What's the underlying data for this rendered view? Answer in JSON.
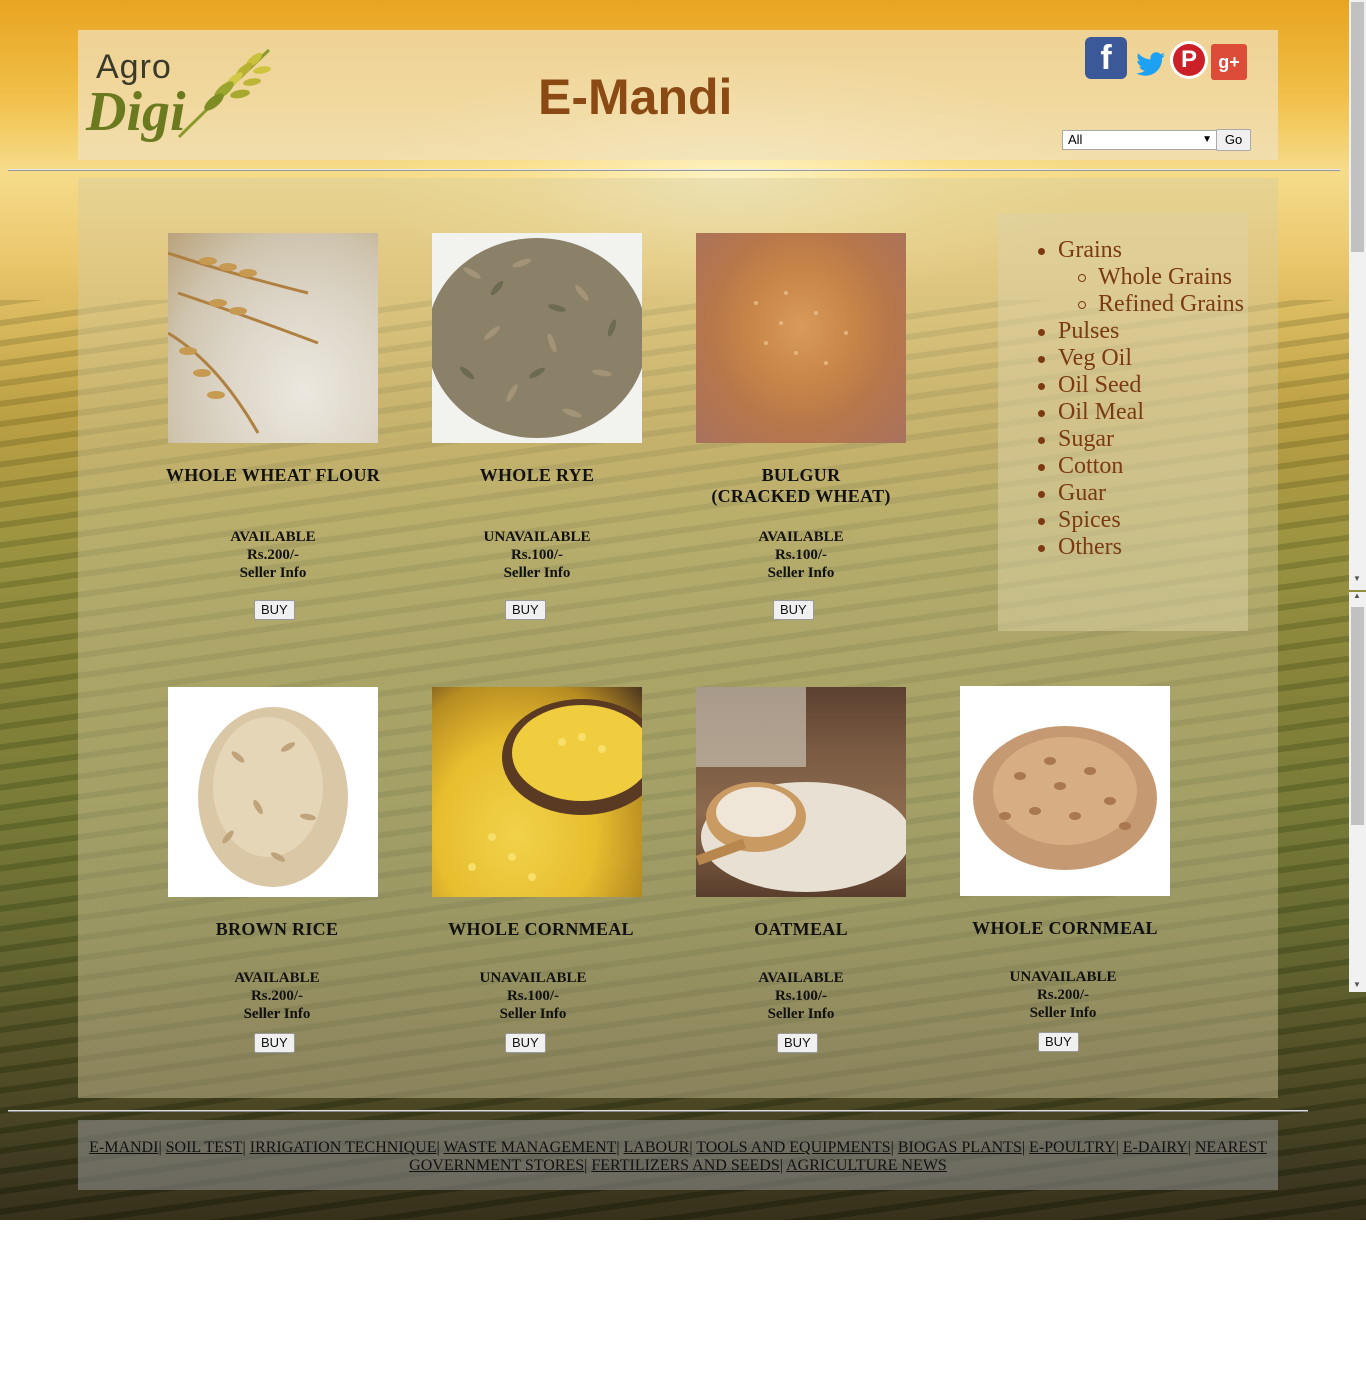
{
  "header": {
    "logo_text_top": "Agro",
    "logo_text_bottom": "Digi",
    "title": "E-Mandi",
    "social": [
      "facebook-icon",
      "twitter-icon",
      "pinterest-icon",
      "google-plus-icon"
    ],
    "filter_select_value": "All",
    "go_label": "Go"
  },
  "products": [
    {
      "name": "WHOLE WHEAT FLOUR",
      "status": "AVAILABLE",
      "price": "Rs.200/-",
      "seller": "Seller Info",
      "buy": "BUY"
    },
    {
      "name": "WHOLE RYE",
      "status": "UNAVAILABLE",
      "price": "Rs.100/-",
      "seller": "Seller Info",
      "buy": "BUY"
    },
    {
      "name_line1": "BULGUR",
      "name_line2": "(CRACKED WHEAT)",
      "status": "AVAILABLE",
      "price": "Rs.100/-",
      "seller": "Seller Info",
      "buy": "BUY"
    },
    {
      "name": "BROWN RICE",
      "status": "AVAILABLE",
      "price": "Rs.200/-",
      "seller": "Seller Info",
      "buy": "BUY"
    },
    {
      "name": "WHOLE CORNMEAL",
      "status": "UNAVAILABLE",
      "price": "Rs.100/-",
      "seller": "Seller Info",
      "buy": "BUY"
    },
    {
      "name": "OATMEAL",
      "status": "AVAILABLE",
      "price": "Rs.100/-",
      "seller": "Seller Info",
      "buy": "BUY"
    },
    {
      "name": "WHOLE CORNMEAL",
      "status": "UNAVAILABLE",
      "price": "Rs.200/-",
      "seller": "Seller Info",
      "buy": "BUY"
    }
  ],
  "categories": [
    {
      "label": "Grains",
      "sub": [
        "Whole Grains",
        "Refined Grains"
      ]
    },
    {
      "label": "Pulses"
    },
    {
      "label": "Veg Oil"
    },
    {
      "label": "Oil Seed"
    },
    {
      "label": "Oil Meal"
    },
    {
      "label": "Sugar"
    },
    {
      "label": "Cotton"
    },
    {
      "label": "Guar"
    },
    {
      "label": "Spices"
    },
    {
      "label": "Others"
    }
  ],
  "footer_links": [
    "E-MANDI",
    "SOIL TEST",
    "IRRIGATION TECHNIQUE",
    "WASTE MANAGEMENT",
    "LABOUR",
    "TOOLS AND EQUIPMENTS",
    "BIOGAS PLANTS",
    "E-POULTRY",
    "E-DAIRY",
    "NEAREST GOVERNMENT STORES",
    "FERTILIZERS AND SEEDS",
    "AGRICULTURE NEWS"
  ],
  "colors": {
    "title": "#8b4a14",
    "category_text": "#7b3a12",
    "facebook": "#3b5998",
    "twitter": "#1da1f2",
    "pinterest": "#cb2027",
    "google_plus": "#dd4b39"
  }
}
